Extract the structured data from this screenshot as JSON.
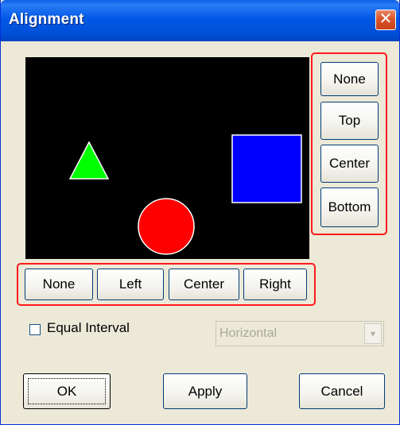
{
  "window": {
    "title": "Alignment",
    "close_glyph": "✕"
  },
  "canvas": {
    "background": "#000000",
    "shapes": [
      {
        "name": "triangle",
        "color": "#00ff00"
      },
      {
        "name": "square",
        "color": "#0000ff"
      },
      {
        "name": "circle",
        "color": "#ff0000"
      }
    ]
  },
  "vertical_align": {
    "buttons": [
      "None",
      "Top",
      "Center",
      "Bottom"
    ]
  },
  "horizontal_align": {
    "buttons": [
      "None",
      "Left",
      "Center",
      "Right"
    ]
  },
  "equal_interval": {
    "label": "Equal Interval",
    "checked": false
  },
  "direction_select": {
    "value": "Horizontal",
    "enabled": false
  },
  "footer": {
    "ok_label": "OK",
    "apply_label": "Apply",
    "cancel_label": "Cancel"
  },
  "highlight_color": "#ff1a1a"
}
